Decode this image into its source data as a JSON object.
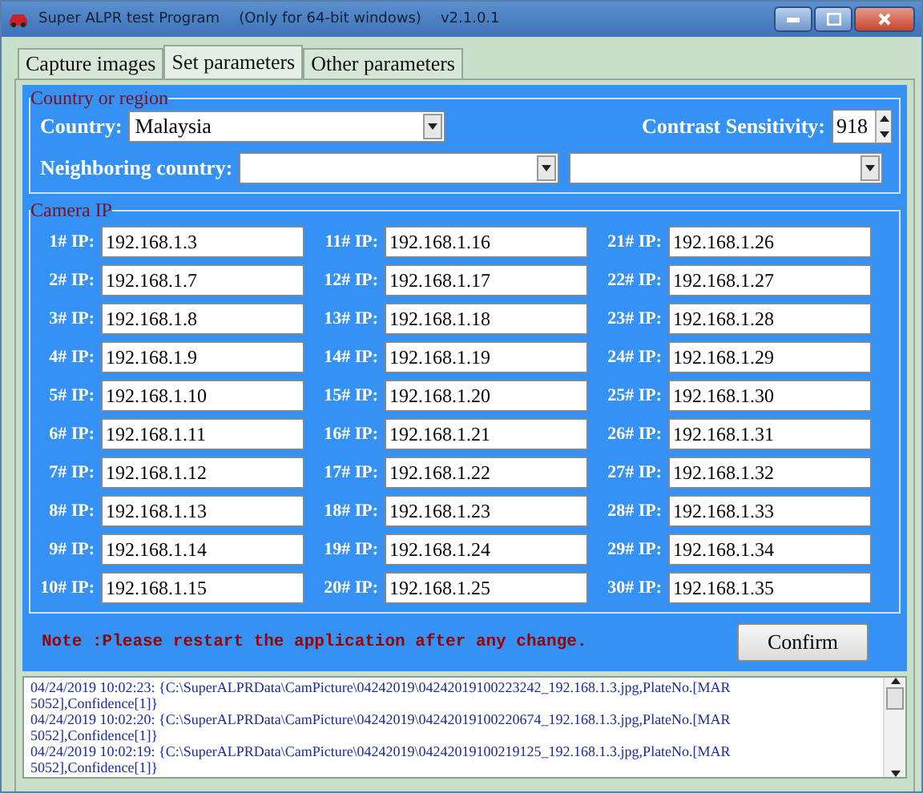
{
  "window": {
    "title_parts": [
      "Super ALPR test Program",
      "(Only for 64-bit windows)",
      "v2.1.0.1"
    ]
  },
  "tabs": [
    {
      "label": "Capture images",
      "selected": false
    },
    {
      "label": "Set parameters",
      "selected": true
    },
    {
      "label": "Other parameters",
      "selected": false
    }
  ],
  "region_group": {
    "legend": "Country or region",
    "country_label": "Country:",
    "country_value": "Malaysia",
    "contrast_label": "Contrast Sensitivity:",
    "contrast_value": "918",
    "neighbor_label": "Neighboring country:"
  },
  "camera_group": {
    "legend": "Camera IP",
    "cameras": [
      {
        "label": "1# IP:",
        "ip": "192.168.1.3"
      },
      {
        "label": "11# IP:",
        "ip": "192.168.1.16"
      },
      {
        "label": "21# IP:",
        "ip": "192.168.1.26"
      },
      {
        "label": "2# IP:",
        "ip": "192.168.1.7"
      },
      {
        "label": "12# IP:",
        "ip": "192.168.1.17"
      },
      {
        "label": "22# IP:",
        "ip": "192.168.1.27"
      },
      {
        "label": "3# IP:",
        "ip": "192.168.1.8"
      },
      {
        "label": "13# IP:",
        "ip": "192.168.1.18"
      },
      {
        "label": "23# IP:",
        "ip": "192.168.1.28"
      },
      {
        "label": "4# IP:",
        "ip": "192.168.1.9"
      },
      {
        "label": "14# IP:",
        "ip": "192.168.1.19"
      },
      {
        "label": "24# IP:",
        "ip": "192.168.1.29"
      },
      {
        "label": "5# IP:",
        "ip": "192.168.1.10"
      },
      {
        "label": "15# IP:",
        "ip": "192.168.1.20"
      },
      {
        "label": "25# IP:",
        "ip": "192.168.1.30"
      },
      {
        "label": "6# IP:",
        "ip": "192.168.1.11"
      },
      {
        "label": "16# IP:",
        "ip": "192.168.1.21"
      },
      {
        "label": "26# IP:",
        "ip": "192.168.1.31"
      },
      {
        "label": "7# IP:",
        "ip": "192.168.1.12"
      },
      {
        "label": "17# IP:",
        "ip": "192.168.1.22"
      },
      {
        "label": "27# IP:",
        "ip": "192.168.1.32"
      },
      {
        "label": "8# IP:",
        "ip": "192.168.1.13"
      },
      {
        "label": "18# IP:",
        "ip": "192.168.1.23"
      },
      {
        "label": "28# IP:",
        "ip": "192.168.1.33"
      },
      {
        "label": "9# IP:",
        "ip": "192.168.1.14"
      },
      {
        "label": "19# IP:",
        "ip": "192.168.1.24"
      },
      {
        "label": "29# IP:",
        "ip": "192.168.1.34"
      },
      {
        "label": "10# IP:",
        "ip": "192.168.1.15"
      },
      {
        "label": "20# IP:",
        "ip": "192.168.1.25"
      },
      {
        "label": "30# IP:",
        "ip": "192.168.1.35"
      }
    ]
  },
  "note": "Note :Please restart the application after any change.",
  "confirm_button": "Confirm",
  "log": [
    "04/24/2019 10:02:23: {C:\\SuperALPRData\\CamPicture\\04242019\\04242019100223242_192.168.1.3.jpg,PlateNo.[MAR 5052],Confidence[1]}",
    "04/24/2019 10:02:20: {C:\\SuperALPRData\\CamPicture\\04242019\\04242019100220674_192.168.1.3.jpg,PlateNo.[MAR 5052],Confidence[1]}",
    "04/24/2019 10:02:19: {C:\\SuperALPRData\\CamPicture\\04242019\\04242019100219125_192.168.1.3.jpg,PlateNo.[MAR 5052],Confidence[1]}"
  ]
}
